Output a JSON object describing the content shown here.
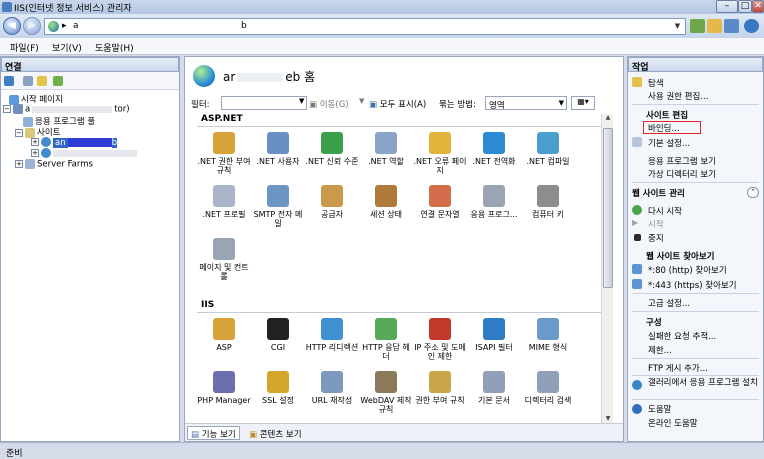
{
  "window": {
    "title": "IIS(인터넷 정보 서비스) 관리자"
  },
  "address": {
    "seg1": "a",
    "seg2": "b"
  },
  "menu": {
    "file": "파일(F)",
    "view": "보기(V)",
    "help": "도움말(H)"
  },
  "left": {
    "title": "연결",
    "tree": [
      {
        "label": "시작 페이지",
        "level": 0
      },
      {
        "label": "a",
        "suffix": "tor)",
        "level": 0
      },
      {
        "label": "응용 프로그램 풀",
        "level": 1
      },
      {
        "label": "사이트",
        "level": 1
      },
      {
        "label": "an",
        "suffix": "b",
        "level": 2,
        "selected": true
      },
      {
        "label": "",
        "level": 2
      },
      {
        "label": "Server Farms",
        "level": 0
      }
    ]
  },
  "center": {
    "title_start": "ar",
    "title_end": "eb 홈",
    "filter": {
      "label": "필터:",
      "go": "이동(G)",
      "show_all": "모두 표시(A)",
      "group_label": "묶는 방법:",
      "group_value": "영역"
    },
    "sections": [
      {
        "name": "ASP.NET",
        "items": [
          {
            "label": ".NET 권한 부여 규칙",
            "icon": "lock-people-icon",
            "color": "#d9a23a"
          },
          {
            "label": ".NET 사용자",
            "icon": "user-icon",
            "color": "#6a8fc7"
          },
          {
            "label": ".NET 신뢰 수준",
            "icon": "trust-check-icon",
            "color": "#3aa14a"
          },
          {
            "label": ".NET 역할",
            "icon": "role-icon",
            "color": "#8aa3c9"
          },
          {
            "label": ".NET 오류 페이지",
            "icon": "error-page-icon",
            "color": "#e2b23a"
          },
          {
            "label": ".NET 전역화",
            "icon": "globalization-icon",
            "color": "#2b8ad2"
          },
          {
            "label": ".NET 컴파일",
            "icon": "compile-icon",
            "color": "#4a9fcf"
          },
          {
            "label": ".NET 프로필",
            "icon": "profile-icon",
            "color": "#a9b6c9"
          },
          {
            "label": "SMTP 전자 메일",
            "icon": "mail-icon",
            "color": "#6c95c4"
          },
          {
            "label": "공급자",
            "icon": "provider-icon",
            "color": "#c99a4a"
          },
          {
            "label": "세션 상태",
            "icon": "session-icon",
            "color": "#b07a3b"
          },
          {
            "label": "연결 문자열",
            "icon": "connection-string-icon",
            "color": "#d46b4a"
          },
          {
            "label": "응용 프로그...",
            "icon": "app-settings-icon",
            "color": "#9aa5b4"
          },
          {
            "label": "컴퓨터 키",
            "icon": "machine-key-icon",
            "color": "#8d8d8d"
          },
          {
            "label": "페이지 및 컨트롤",
            "icon": "pages-controls-icon",
            "color": "#9aa5b4"
          }
        ]
      },
      {
        "name": "IIS",
        "items": [
          {
            "label": "ASP",
            "icon": "asp-icon",
            "color": "#d9a23a"
          },
          {
            "label": "CGI",
            "icon": "cgi-icon",
            "color": "#222222"
          },
          {
            "label": "HTTP 리디렉션",
            "icon": "redirect-icon",
            "color": "#3f8fd1"
          },
          {
            "label": "HTTP 응답 헤더",
            "icon": "response-header-icon",
            "color": "#58a85a"
          },
          {
            "label": "IP 주소 및 도메인 제한",
            "icon": "ip-restrict-icon",
            "color": "#c0392b"
          },
          {
            "label": "ISAPI 필터",
            "icon": "isapi-icon",
            "color": "#2e7cc4"
          },
          {
            "label": "MIME 형식",
            "icon": "mime-icon",
            "color": "#6a9ac9"
          },
          {
            "label": "PHP Manager",
            "icon": "php-icon",
            "color": "#6b6fae"
          },
          {
            "label": "SSL 설정",
            "icon": "ssl-lock-icon",
            "color": "#d4a72c"
          },
          {
            "label": "URL 재작성",
            "icon": "url-rewrite-icon",
            "color": "#7d99be"
          },
          {
            "label": "WebDAV 제작 규칙",
            "icon": "webdav-icon",
            "color": "#8a7a5a"
          },
          {
            "label": "권한 부여 규칙",
            "icon": "authz-icon",
            "color": "#c9a64a"
          },
          {
            "label": "기본 문서",
            "icon": "default-doc-icon",
            "color": "#8fa0b8"
          },
          {
            "label": "디렉터리 검색",
            "icon": "dir-browse-icon",
            "color": "#8fa0b8"
          }
        ]
      }
    ],
    "bottom": {
      "features": "기능 보기",
      "content": "콘텐츠 보기"
    }
  },
  "right": {
    "title": "작업",
    "explore": "탐색",
    "edit_perm": "사용 권한 편집...",
    "site_edit_hd": "사이트 편집",
    "bindings": "바인딩...",
    "basic": "기본 설정...",
    "view_apps": "응용 프로그램 보기",
    "view_vdirs": "가상 디렉터리 보기",
    "manage_hd": "웹 사이트 관리",
    "restart": "다시 시작",
    "start": "시작",
    "stop": "중지",
    "browse_hd": "웹 사이트 찾아보기",
    "browse80": "*:80 (http) 찾아보기",
    "browse443": "*:443 (https) 찾아보기",
    "advanced": "고급 설정...",
    "config_hd": "구성",
    "failed": "실패한 요청 추적...",
    "limits": "제한...",
    "ftp": "FTP 게시 추가...",
    "gallery": "갤러리에서 응용 프로그램 설치",
    "help": "도움말",
    "online_help": "온라인 도움말"
  },
  "status": {
    "text": "준비"
  }
}
